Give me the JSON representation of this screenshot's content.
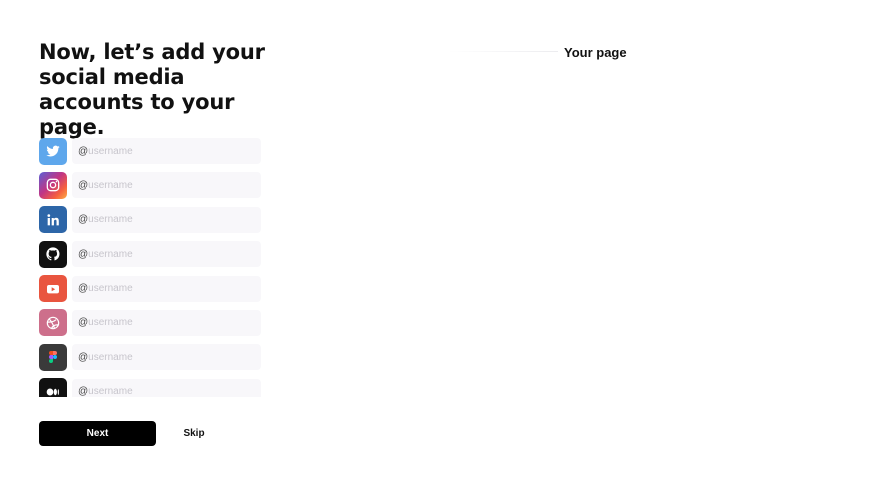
{
  "heading": "Now, let’s add your social media accounts to your page.",
  "accounts": [
    {
      "name": "Twitter",
      "icon": "twitter-icon",
      "prefix": "@",
      "value": "",
      "placeholder": "username",
      "color": "#5ea7ec"
    },
    {
      "name": "Instagram",
      "icon": "instagram-icon",
      "prefix": "@",
      "value": "",
      "placeholder": "username",
      "color": "#c13584"
    },
    {
      "name": "LinkedIn",
      "icon": "linkedin-icon",
      "prefix": "@",
      "value": "",
      "placeholder": "username",
      "color": "#2d66a8"
    },
    {
      "name": "GitHub",
      "icon": "github-icon",
      "prefix": "@",
      "value": "",
      "placeholder": "username",
      "color": "#111111"
    },
    {
      "name": "YouTube",
      "icon": "youtube-icon",
      "prefix": "@",
      "value": "",
      "placeholder": "username",
      "color": "#e9553f"
    },
    {
      "name": "Dribbble",
      "icon": "dribbble-icon",
      "prefix": "@",
      "value": "",
      "placeholder": "username",
      "color": "#cd6f8b"
    },
    {
      "name": "Figma",
      "icon": "figma-icon",
      "prefix": "@",
      "value": "",
      "placeholder": "username",
      "color": "#3a3a3a"
    },
    {
      "name": "Medium",
      "icon": "medium-icon",
      "prefix": "@",
      "value": "",
      "placeholder": "username",
      "color": "#111111"
    }
  ],
  "actions": {
    "next_label": "Next",
    "skip_label": "Skip"
  },
  "preview": {
    "title": "Your page"
  }
}
